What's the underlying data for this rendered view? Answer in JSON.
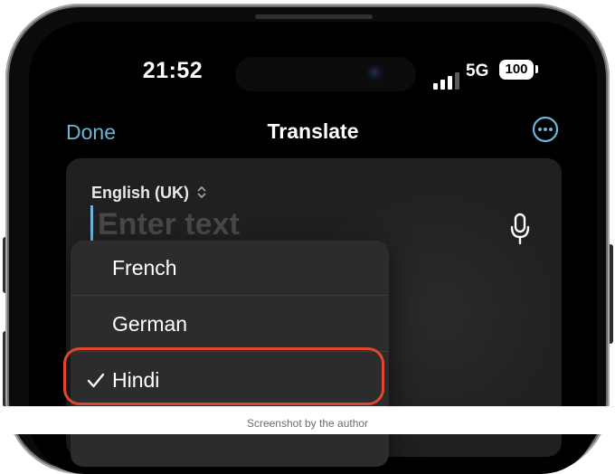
{
  "status_bar": {
    "time": "21:52",
    "network": "5G",
    "battery": "100"
  },
  "nav": {
    "done_label": "Done",
    "title": "Translate",
    "more_icon": "ellipsis-circle-icon"
  },
  "source": {
    "language_label": "English (UK)",
    "input_placeholder": "Enter text",
    "input_value": "",
    "mic_icon": "microphone-icon"
  },
  "language_menu": {
    "items": [
      {
        "label": "French",
        "selected": false
      },
      {
        "label": "German",
        "selected": false
      },
      {
        "label": "Hindi",
        "selected": true
      }
    ]
  },
  "caption": "Screenshot by the author",
  "colors": {
    "accent": "#6db4d6",
    "highlight": "#e0462e",
    "card": "#202022",
    "menu": "#2c2c2e"
  }
}
